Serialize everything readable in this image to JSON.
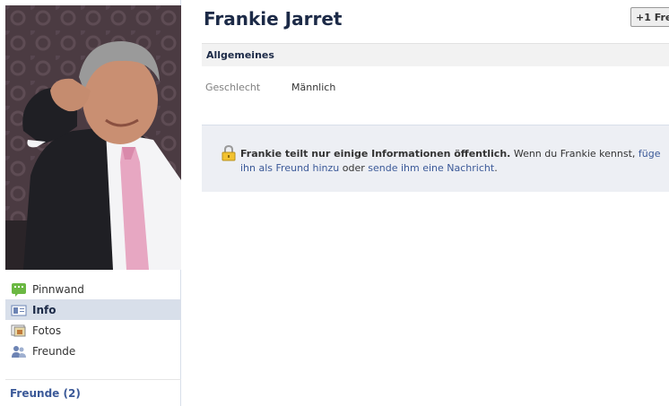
{
  "profile": {
    "name": "Frankie Jarret",
    "add_friend_label": "+1 Freund"
  },
  "nav": {
    "items": [
      {
        "label": "Pinnwand",
        "icon": "wall-icon"
      },
      {
        "label": "Info",
        "icon": "info-icon",
        "active": true
      },
      {
        "label": "Fotos",
        "icon": "photos-icon"
      },
      {
        "label": "Freunde",
        "icon": "friends-icon"
      }
    ],
    "friends_count": "Freunde (2)"
  },
  "info": {
    "section_title": "Allgemeines",
    "gender_label": "Geschlecht",
    "gender_value": "Männlich"
  },
  "privacy": {
    "strong": "Frankie teilt nur einige Informationen öffentlich.",
    "text1": " Wenn du Frankie kennst, ",
    "link1": "füge ihn als Freund hinzu",
    "text2": " oder ",
    "link2": "sende ihm eine Nachricht",
    "text3": "."
  },
  "colors": {
    "link": "#3b5998",
    "nav_active": "#d8dfea",
    "privacy_bg": "#edeff4"
  }
}
